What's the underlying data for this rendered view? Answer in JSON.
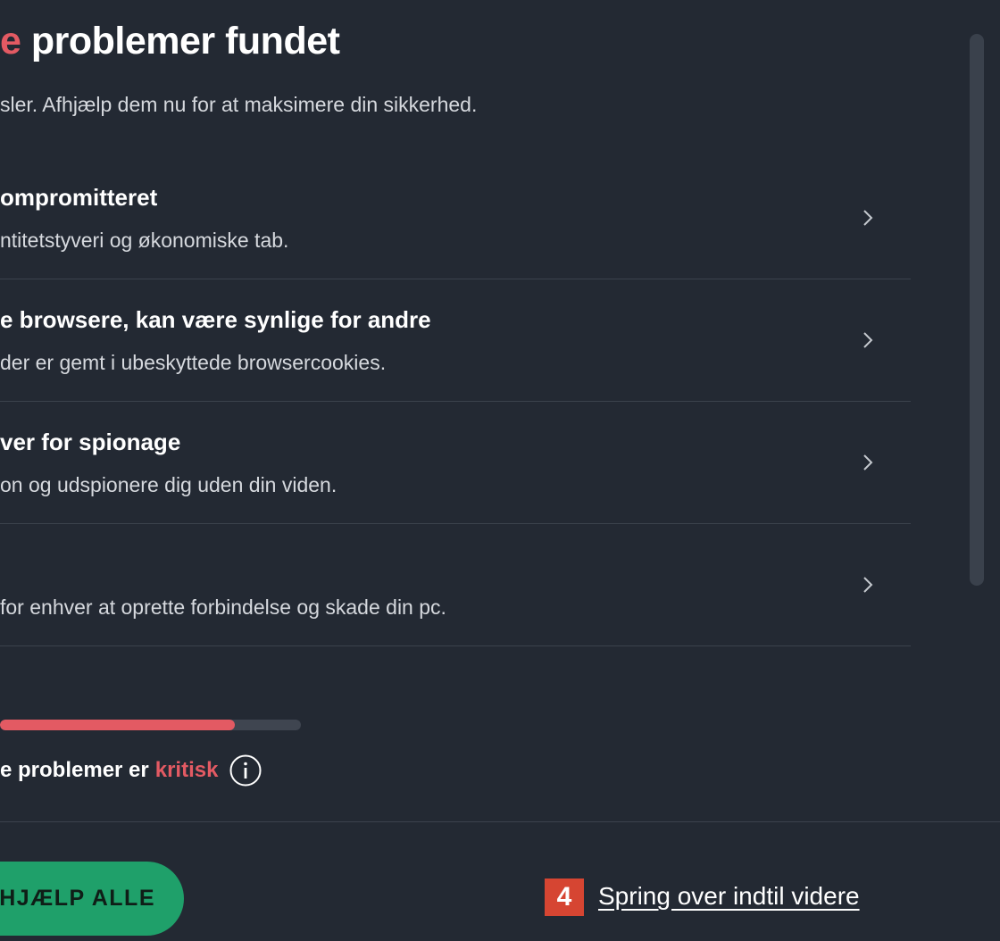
{
  "header": {
    "title_accent": "e",
    "title_rest": " problemer fundet",
    "subtitle": "sler. Afhjælp dem nu for at maksimere din sikkerhed."
  },
  "issues": [
    {
      "title": "ompromitteret",
      "description": "ntitetstyveri og økonomiske tab."
    },
    {
      "title": "e browsere, kan være synlige for andre",
      "description": "der er gemt i ubeskyttede browsercookies."
    },
    {
      "title": "ver for spionage",
      "description": "on og udspionere dig uden din viden."
    },
    {
      "title": "",
      "description": " for enhver at oprette forbindelse og skade din pc."
    }
  ],
  "severity": {
    "progress_fraction": 0.78,
    "label_prefix": "e problemer er",
    "level": "kritisk"
  },
  "footer": {
    "fix_all_label": "HJÆLP ALLE",
    "step_number": "4",
    "skip_label": "Spring over indtil videre"
  },
  "icons": {
    "chevron": "chevron-right-icon",
    "info": "info-icon"
  },
  "colors": {
    "background": "#232933",
    "critical": "#e35a63",
    "primary_button": "#1fa06a",
    "step_badge": "#d64532"
  }
}
